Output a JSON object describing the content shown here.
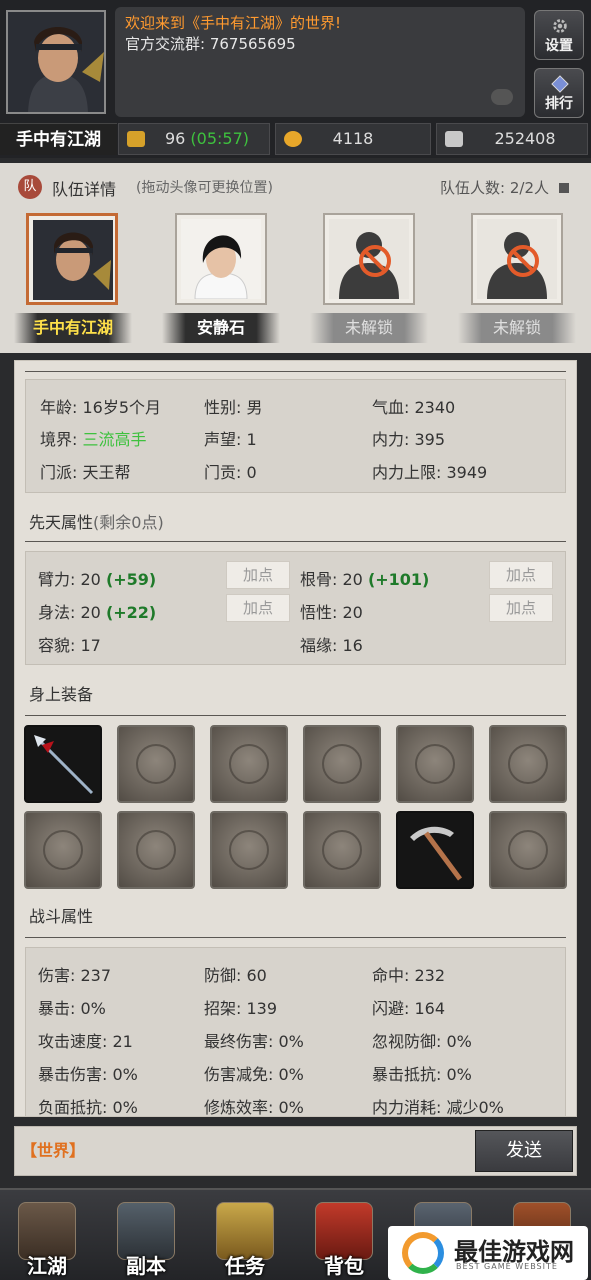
{
  "header": {
    "welcome_line": "欢迎来到《手中有江湖》的世界!",
    "group_line": "官方交流群: 767565695",
    "player_name": "手中有江湖",
    "settings_label": "设置",
    "rank_label": "排行",
    "stamina": "96",
    "stamina_timer": "(05:57)",
    "gold": "4118",
    "silver": "252408"
  },
  "team": {
    "title": "队伍详情",
    "subtitle": "(拖动头像可更换位置)",
    "count": "队伍人数: 2/2人",
    "members": [
      {
        "name": "手中有江湖",
        "state": "active"
      },
      {
        "name": "安静石",
        "state": "member"
      },
      {
        "name": "未解锁",
        "state": "locked"
      },
      {
        "name": "未解锁",
        "state": "locked"
      }
    ]
  },
  "basic": {
    "age": "年龄: 16岁5个月",
    "gender": "性别: 男",
    "hp": "气血: 2340",
    "realm_label": "境界: ",
    "realm_value": "三流高手",
    "fame": "声望: 1",
    "inner": "内力: 395",
    "sect": "门派: 天王帮",
    "contrib": "门贡: 0",
    "inner_max": "内力上限: 3949"
  },
  "innate": {
    "title": "先天属性",
    "remaining": "(剩余0点)",
    "add_label": "加点",
    "arm": "臂力: 20",
    "arm_bonus": "(+59)",
    "root": "根骨: 20",
    "root_bonus": "(+101)",
    "agility": "身法: 20",
    "agility_bonus": "(+22)",
    "insight": "悟性: 20",
    "looks": "容貌: 17",
    "luck": "福缘: 16"
  },
  "equipment": {
    "title": "身上装备",
    "slots": [
      {
        "icon": "spear-icon",
        "owned": true
      },
      {
        "icon": "hidden-weapon-icon",
        "owned": false
      },
      {
        "icon": "robe-icon",
        "owned": false
      },
      {
        "icon": "armor-icon",
        "owned": false
      },
      {
        "icon": "boots-icon",
        "owned": false
      },
      {
        "icon": "pendant-icon",
        "owned": false
      },
      {
        "icon": "bracelet-icon",
        "owned": false
      },
      {
        "icon": "talisman-icon",
        "owned": false
      },
      {
        "icon": "beads-icon",
        "owned": false
      },
      {
        "icon": "ring-icon",
        "owned": false
      },
      {
        "icon": "pickaxe-icon",
        "owned": true
      },
      {
        "icon": "horse-icon",
        "owned": false
      }
    ]
  },
  "combat": {
    "title": "战斗属性",
    "stats": [
      [
        "伤害: 237",
        "防御: 60",
        "命中: 232"
      ],
      [
        "暴击: 0%",
        "招架: 139",
        "闪避: 164"
      ],
      [
        "攻击速度: 21",
        "最终伤害: 0%",
        "忽视防御: 0%"
      ],
      [
        "暴击伤害: 0%",
        "伤害减免: 0%",
        "暴击抵抗: 0%"
      ],
      [
        "负面抵抗: 0%",
        "修炼效率: 0%",
        "内力消耗: 减少0%"
      ]
    ]
  },
  "chat": {
    "channel": "【世界】",
    "send": "发送"
  },
  "nav": {
    "items": [
      "江湖",
      "副本",
      "任务",
      "背包",
      "",
      ""
    ]
  },
  "watermark": {
    "title": "最佳游戏网",
    "sub": "BEST GAME WEBSITE"
  },
  "colors": {
    "accent_orange": "#ff9a2f",
    "green": "#3ec13e",
    "gold_name": "#ffe14a"
  }
}
